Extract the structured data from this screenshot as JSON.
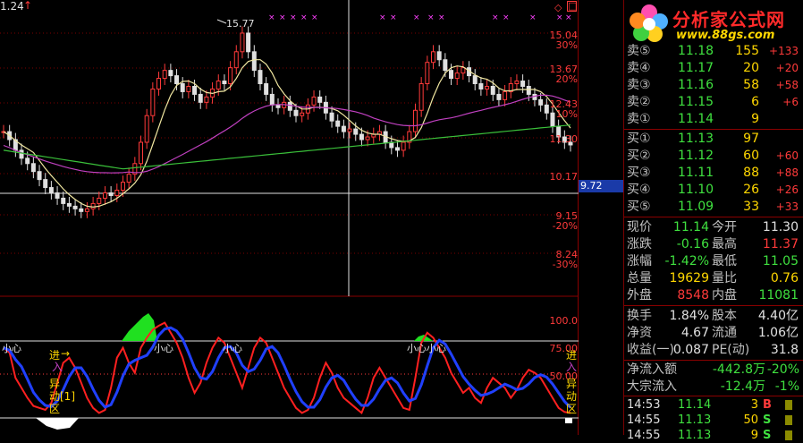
{
  "top_left_value": "1.24",
  "peak_label": "15.77",
  "current_price_tag": "9.72",
  "price_axis": [
    {
      "price": "15.04",
      "pct": "30%"
    },
    {
      "price": "13.67",
      "pct": "20%"
    },
    {
      "price": "12.43",
      "pct": "10%"
    },
    {
      "price": "11.30",
      "pct": ""
    },
    {
      "price": "10.17",
      "pct": ""
    },
    {
      "price": "9.15",
      "pct": "-20%"
    },
    {
      "price": "8.24",
      "pct": "-30%"
    }
  ],
  "indicator_axis": [
    "100.0",
    "75.00",
    "50.00"
  ],
  "indicator_labels": {
    "left_enter": "进",
    "left_enter2": "入",
    "left_abnormal": "异",
    "left_abnormal2": "动[1]",
    "left_zone": "区",
    "right_enter": "进",
    "right_enter2": "入",
    "right_abnormal": "异",
    "right_abnormal2": "动",
    "right_zone": "区",
    "careful": "小心"
  },
  "logo": {
    "title": "分析家公式网",
    "url": "www.88gs.com"
  },
  "sell_orders": [
    {
      "label": "卖⑤",
      "price": "11.18",
      "vol": "155",
      "chg": "+133"
    },
    {
      "label": "卖④",
      "price": "11.17",
      "vol": "20",
      "chg": "+20"
    },
    {
      "label": "卖③",
      "price": "11.16",
      "vol": "58",
      "chg": "+58"
    },
    {
      "label": "卖②",
      "price": "11.15",
      "vol": "6",
      "chg": "+6"
    },
    {
      "label": "卖①",
      "price": "11.14",
      "vol": "9",
      "chg": ""
    }
  ],
  "buy_orders": [
    {
      "label": "买①",
      "price": "11.13",
      "vol": "97",
      "chg": ""
    },
    {
      "label": "买②",
      "price": "11.12",
      "vol": "60",
      "chg": "+60"
    },
    {
      "label": "买③",
      "price": "11.11",
      "vol": "88",
      "chg": "+88"
    },
    {
      "label": "买④",
      "price": "11.10",
      "vol": "26",
      "chg": "+26"
    },
    {
      "label": "买⑤",
      "price": "11.09",
      "vol": "33",
      "chg": "+33"
    }
  ],
  "quote": [
    {
      "l1": "现价",
      "v1": "11.14",
      "c1": "green",
      "l2": "今开",
      "v2": "11.30",
      "c2": "white"
    },
    {
      "l1": "涨跌",
      "v1": "-0.16",
      "c1": "green",
      "l2": "最高",
      "v2": "11.37",
      "c2": "red"
    },
    {
      "l1": "涨幅",
      "v1": "-1.42%",
      "c1": "green",
      "l2": "最低",
      "v2": "11.05",
      "c2": "green"
    },
    {
      "l1": "总量",
      "v1": "19629",
      "c1": "yellow",
      "l2": "量比",
      "v2": "0.76",
      "c2": "yellow"
    },
    {
      "l1": "外盘",
      "v1": "8548",
      "c1": "red",
      "l2": "内盘",
      "v2": "11081",
      "c2": "green"
    }
  ],
  "stats": [
    {
      "l1": "换手",
      "v1": "1.84%",
      "l2": "股本",
      "v2": "4.40亿"
    },
    {
      "l1": "净资",
      "v1": "4.67",
      "l2": "流通",
      "v2": "1.06亿"
    },
    {
      "l1": "收益(一)",
      "v1": "0.087",
      "l2": "PE(动)",
      "v2": "31.8"
    }
  ],
  "flows": [
    {
      "label": "净流入额",
      "value": "-442.8万",
      "pct": "-20%"
    },
    {
      "label": "大宗流入",
      "value": "-12.4万",
      "pct": "-1%"
    }
  ],
  "ticks": [
    {
      "time": "14:53",
      "price": "11.14",
      "vol": "3",
      "side": "B",
      "side_color": "red"
    },
    {
      "time": "14:55",
      "price": "11.13",
      "vol": "50",
      "side": "S",
      "side_color": "green"
    },
    {
      "time": "14:55",
      "price": "11.13",
      "vol": "9",
      "side": "S",
      "side_color": "green"
    }
  ],
  "colors": {
    "up": "#ff3a3a",
    "down": "#3fe03f",
    "ma_short": "#f0e6a0",
    "ma_mid": "#c040c0",
    "ma_long": "#3ac03a",
    "indicator_red": "#ff2020",
    "indicator_blue": "#2040ff"
  }
}
